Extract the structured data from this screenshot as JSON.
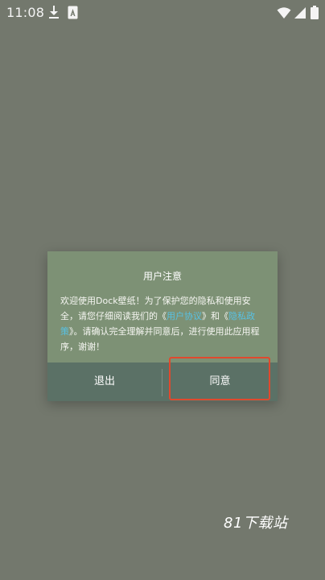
{
  "status_bar": {
    "time": "11:08",
    "icons": [
      "download-icon",
      "a-icon",
      "wifi-icon",
      "signal-icon",
      "battery-icon"
    ]
  },
  "dialog": {
    "title": "用户注意",
    "message": {
      "part1": "欢迎使用Dock壁纸！为了保护您的隐私和使用安全，请您仔细阅读我们的《",
      "link1": "用户协议",
      "part2": "》和《",
      "link2": "隐私政策",
      "part3": "》。请确认完全理解并同意后，进行使用此应用程序，谢谢！"
    },
    "exit_label": "退出",
    "agree_label": "同意"
  },
  "watermark": "81下载站",
  "colors": {
    "background": "#73786d",
    "dialog_background": "#7d9175",
    "button_bar": "#5b7166",
    "link": "#58c1e3",
    "highlight": "#e0492e"
  }
}
